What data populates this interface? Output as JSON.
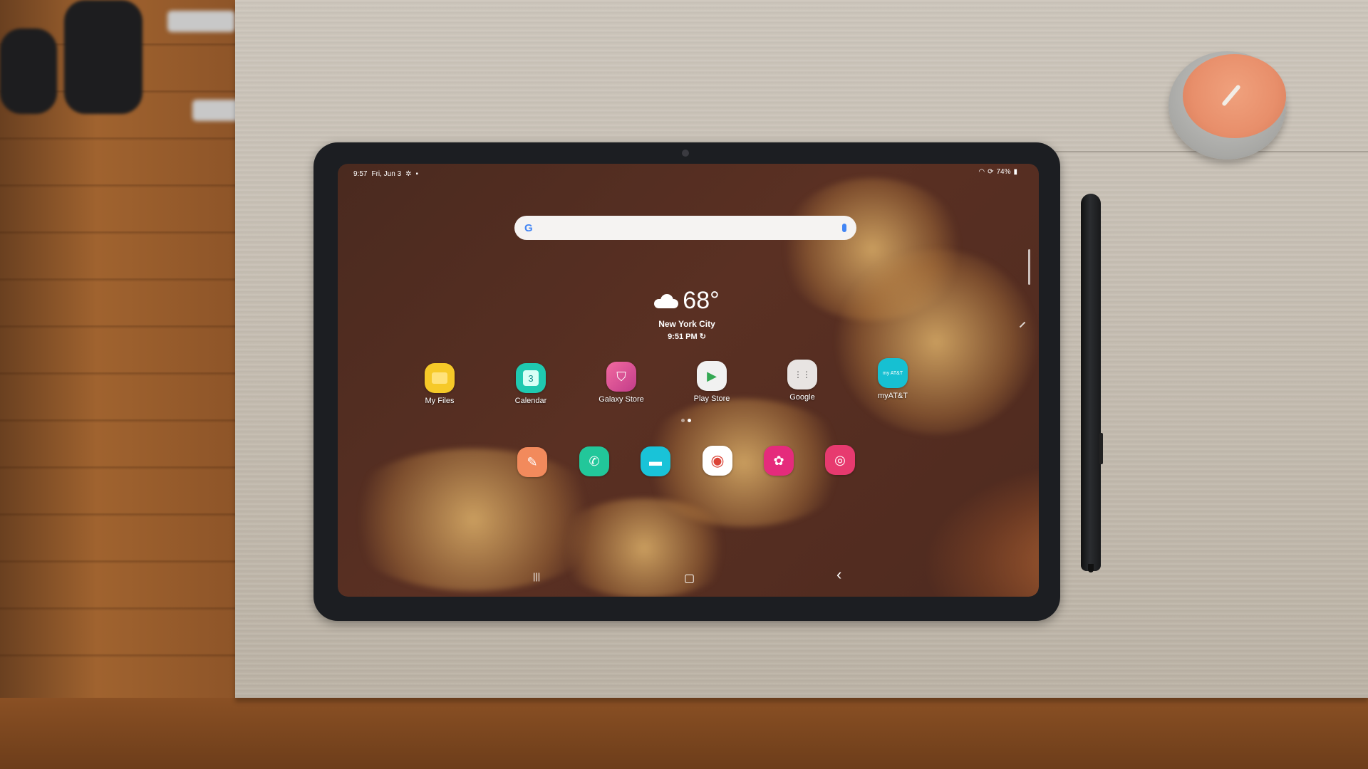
{
  "status_bar": {
    "time": "9:57",
    "date": "Fri, Jun 3",
    "left_icons": [
      "settings-icon",
      "notification-icon"
    ],
    "battery": "74%",
    "right_icons": [
      "wifi-icon",
      "sync-icon",
      "battery-icon"
    ]
  },
  "search_bar": {
    "logo": "G",
    "mic": "mic-icon"
  },
  "weather": {
    "icon": "cloud-icon",
    "temperature": "68°",
    "city": "New York City",
    "updated_time": "9:51 PM",
    "refresh_icon": "↻"
  },
  "apps": [
    {
      "label": "My Files",
      "icon": "folder-icon",
      "color": "#f6c928",
      "glyph": "▭"
    },
    {
      "label": "Calendar",
      "icon": "calendar-icon",
      "color": "#1fc9b0",
      "glyph": "3"
    },
    {
      "label": "Galaxy Store",
      "icon": "galaxy-store-icon",
      "color": "#e0488f",
      "glyph": "⛉"
    },
    {
      "label": "Play Store",
      "icon": "play-store-icon",
      "color": "#f1f1f1",
      "glyph": "▶"
    },
    {
      "label": "Google",
      "icon": "google-folder-icon",
      "color": "#e8e4e2",
      "glyph": "⋮⋮"
    },
    {
      "label": "myAT&T",
      "icon": "myatt-icon",
      "color": "#16c0d2",
      "glyph": "my AT&T"
    }
  ],
  "page_indicator": {
    "count": 2,
    "active": 1
  },
  "dock": [
    {
      "name": "notes",
      "icon": "samsung-notes-icon",
      "color": "#f28a5c",
      "glyph": "✎"
    },
    {
      "name": "phone",
      "icon": "phone-icon",
      "color": "#22c79a",
      "glyph": "✆"
    },
    {
      "name": "messages",
      "icon": "messages-icon",
      "color": "#19c3d8",
      "glyph": "▬"
    },
    {
      "name": "chrome",
      "icon": "chrome-icon",
      "color": "#ffffff",
      "glyph": "◉"
    },
    {
      "name": "gallery",
      "icon": "gallery-icon",
      "color": "#e52b7c",
      "glyph": "✿"
    },
    {
      "name": "camera",
      "icon": "camera-icon",
      "color": "#e73a6f",
      "glyph": "◎"
    }
  ],
  "navigation": {
    "recents": "|||",
    "home": "▢",
    "back": "‹"
  }
}
